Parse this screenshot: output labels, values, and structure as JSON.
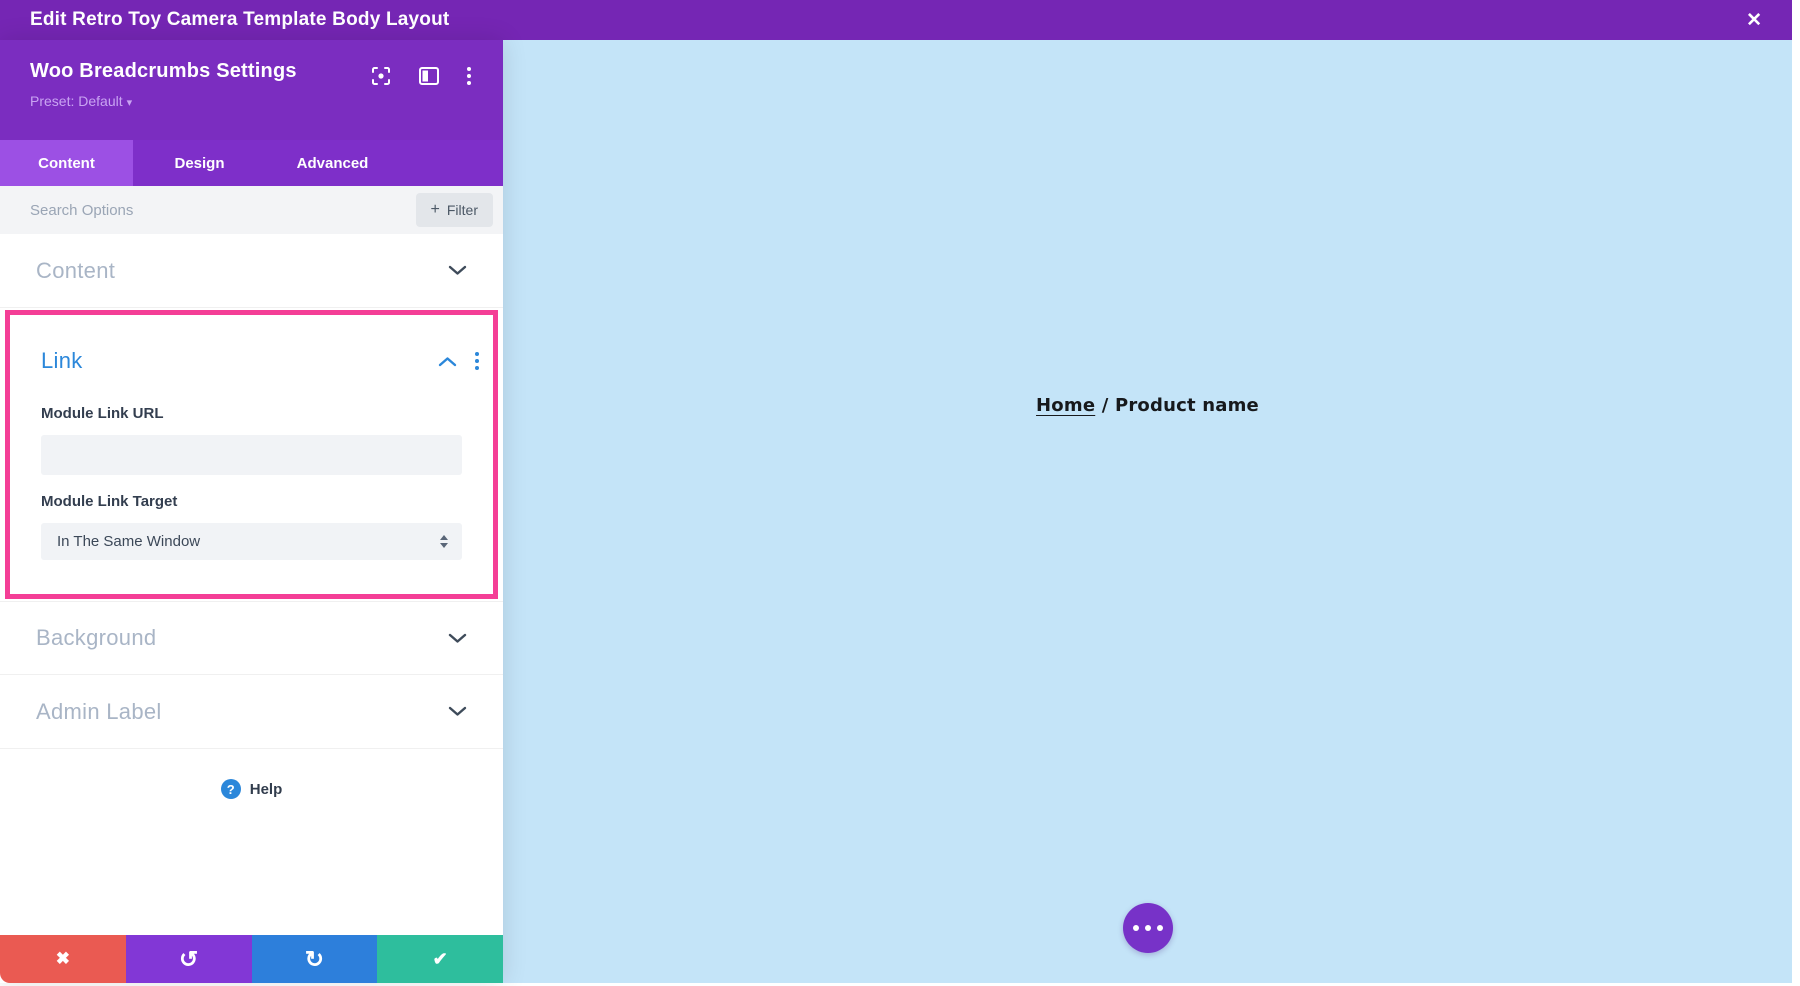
{
  "topbar": {
    "title": "Edit Retro Toy Camera Template Body Layout",
    "close_icon": "✕"
  },
  "panel": {
    "title": "Woo Breadcrumbs Settings",
    "preset": {
      "label": "Preset: Default",
      "caret_icon": "▾"
    },
    "tabs": [
      {
        "label": "Content"
      },
      {
        "label": "Design"
      },
      {
        "label": "Advanced"
      }
    ],
    "active_tab": "Content",
    "search": {
      "placeholder": "Search Options",
      "filter_plus": "+",
      "filter_label": "Filter"
    },
    "sections": {
      "content": {
        "label": "Content",
        "state": "collapsed"
      },
      "link": {
        "label": "Link",
        "state": "expanded",
        "highlight_color": "#F43E96",
        "fields": [
          {
            "label": "Module Link URL",
            "type": "text",
            "value": ""
          },
          {
            "label": "Module Link Target",
            "type": "select",
            "value": "In The Same Window"
          }
        ]
      },
      "background": {
        "label": "Background",
        "state": "collapsed"
      },
      "admin_label": {
        "label": "Admin Label",
        "state": "collapsed"
      }
    },
    "help": {
      "icon": "?",
      "label": "Help"
    },
    "footer": {
      "discard_icon": "✖",
      "undo_icon": "↺",
      "redo_icon": "↻",
      "save_icon": "✔"
    }
  },
  "preview": {
    "breadcrumb": {
      "home": "Home",
      "separator": " / ",
      "current": "Product name"
    }
  },
  "colors": {
    "topbar_purple": "#7526B4",
    "header_purple": "#7B2DC0",
    "tabbar_purple": "#7E2FC9",
    "active_tab_purple": "#9C50E4",
    "highlight_pink": "#F43E96",
    "accent_blue": "#2B87DA",
    "preview_background_blue": "#C4E4F8",
    "discard_red": "#EA5A52",
    "undo_purple": "#8237D6",
    "redo_blue": "#2D7FDB",
    "save_green": "#2EBE9D",
    "more_button_purple": "#7732C8"
  }
}
